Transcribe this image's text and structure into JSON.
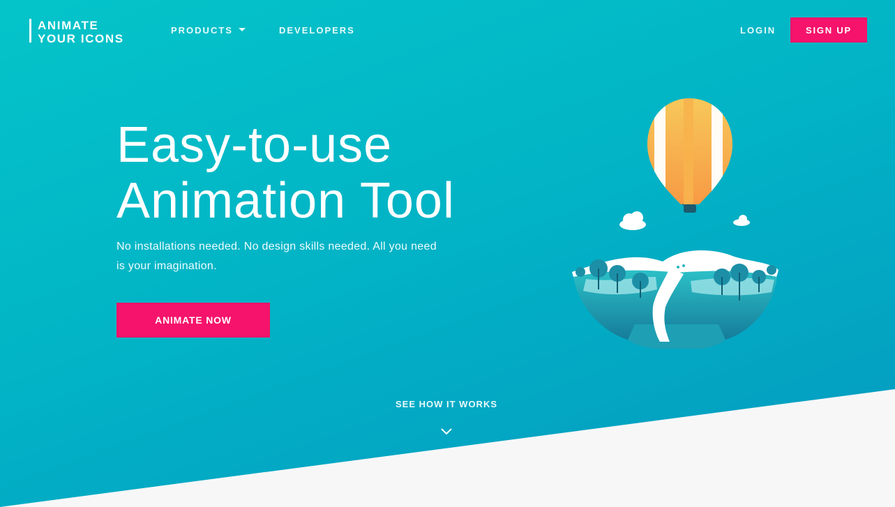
{
  "brand": {
    "line1": "ANIMATE",
    "line2": "YOUR ICONS"
  },
  "nav": {
    "products": "PRODUCTS",
    "developers": "DEVELOPERS",
    "login": "LOGIN",
    "signup": "SIGN UP"
  },
  "hero": {
    "headline_line1": "Easy-to-use",
    "headline_line2": "Animation Tool",
    "subtext": "No installations needed. No design skills needed. All you need is your imagination.",
    "cta": "ANIMATE NOW",
    "see_how": "SEE HOW IT WORKS"
  },
  "icons": {
    "products_dropdown": "caret-down-icon",
    "scroll_down": "chevron-down-icon",
    "illustration": "hot-air-balloon-island-illustration"
  },
  "colors": {
    "accent": "#f5136b",
    "hero_start": "#04c4c9",
    "hero_end": "#0499c0",
    "band": "#f7f7f8",
    "balloon_orange": "#f8a64a",
    "island_teal": "#2bb7c0"
  }
}
